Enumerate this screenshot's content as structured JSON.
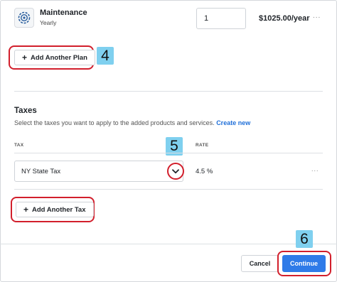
{
  "plan": {
    "name": "Maintenance",
    "cycle": "Yearly",
    "quantity": "1",
    "price": "$1025.00/year",
    "more": "..."
  },
  "add_plan": {
    "plus": "+",
    "label": "Add Another Plan"
  },
  "taxes": {
    "title": "Taxes",
    "description": "Select the taxes you want to apply to the added products and services.",
    "create_link": "Create new",
    "col_tax": "TAX",
    "col_rate": "RATE",
    "row": {
      "tax": "NY State Tax",
      "rate": "4.5 %",
      "more": "..."
    }
  },
  "add_tax": {
    "plus": "+",
    "label": "Add Another Tax"
  },
  "footer": {
    "cancel": "Cancel",
    "continue": "Continue"
  },
  "annotations": {
    "plan_step": "4",
    "select_step": "5",
    "continue_step": "6"
  },
  "colors": {
    "highlight": "#d21f2c",
    "badge": "#7fd0ef",
    "primary": "#2f7be8"
  },
  "icons": {
    "plan": "gear-icon",
    "dropdown": "chevron-down-icon"
  }
}
